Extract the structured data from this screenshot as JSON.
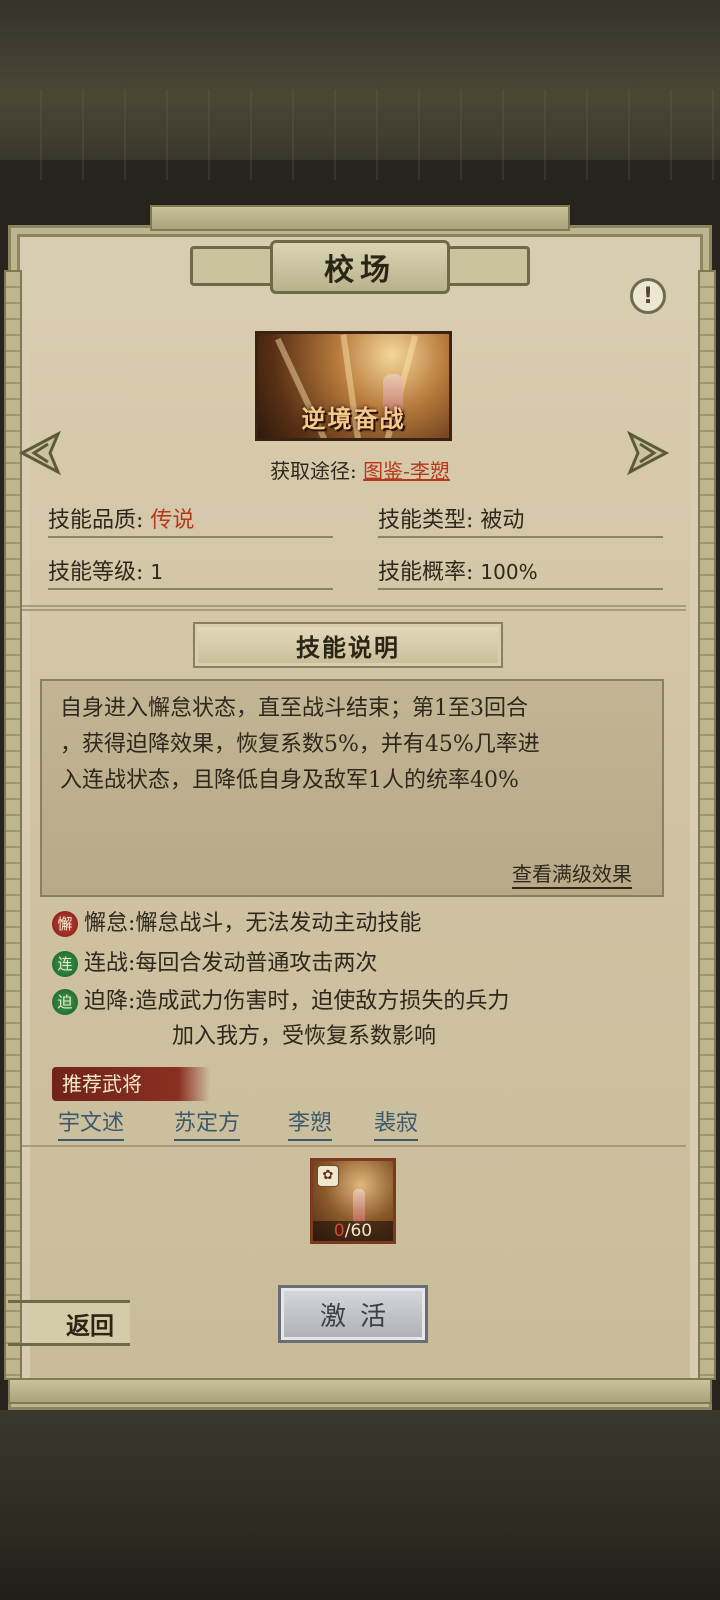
{
  "header": {
    "title": "校场"
  },
  "skill": {
    "card_name": "逆境奋战",
    "source_label": "获取途径:",
    "source_value": "图鉴-李愬",
    "quality_label": "技能品质:",
    "quality_value": "传说",
    "type_label": "技能类型:",
    "type_value": "被动",
    "level_label": "技能等级:",
    "level_value": "1",
    "chance_label": "技能概率:",
    "chance_value": "100%"
  },
  "description": {
    "header": "技能说明",
    "line1": "自身进入懈怠状态，直至战斗结束；第1至3回合",
    "line2": "，获得迫降效果，恢复系数5%，并有45%几率进",
    "line3": "入连战状态，且降低自身及敌军1人的统率40%",
    "full_level_link": "查看满级效果"
  },
  "effects": [
    {
      "icon": "懈",
      "label": "懈怠:",
      "text": "懈怠战斗，无法发动主动技能",
      "color": "red"
    },
    {
      "icon": "连",
      "label": "连战:",
      "text": "每回合发动普通攻击两次",
      "color": "green"
    },
    {
      "icon": "迫",
      "label": "迫降:",
      "text": "造成武力伤害时，迫使敌方损失的兵力",
      "text2": "加入我方，受恢复系数影响",
      "color": "green"
    }
  ],
  "recommend": {
    "label": "推荐武将",
    "heroes": [
      "宇文述",
      "苏定方",
      "李愬",
      "裴寂"
    ]
  },
  "item": {
    "owned": "0",
    "required": "/60",
    "badge_icon": "puzzle-piece-icon"
  },
  "buttons": {
    "activate": "激活",
    "back": "返回",
    "info": "!"
  },
  "colors": {
    "accent_red": "#b5391b",
    "link_blue": "#3c5a6e",
    "panel_bg": "#d8cdb1"
  }
}
